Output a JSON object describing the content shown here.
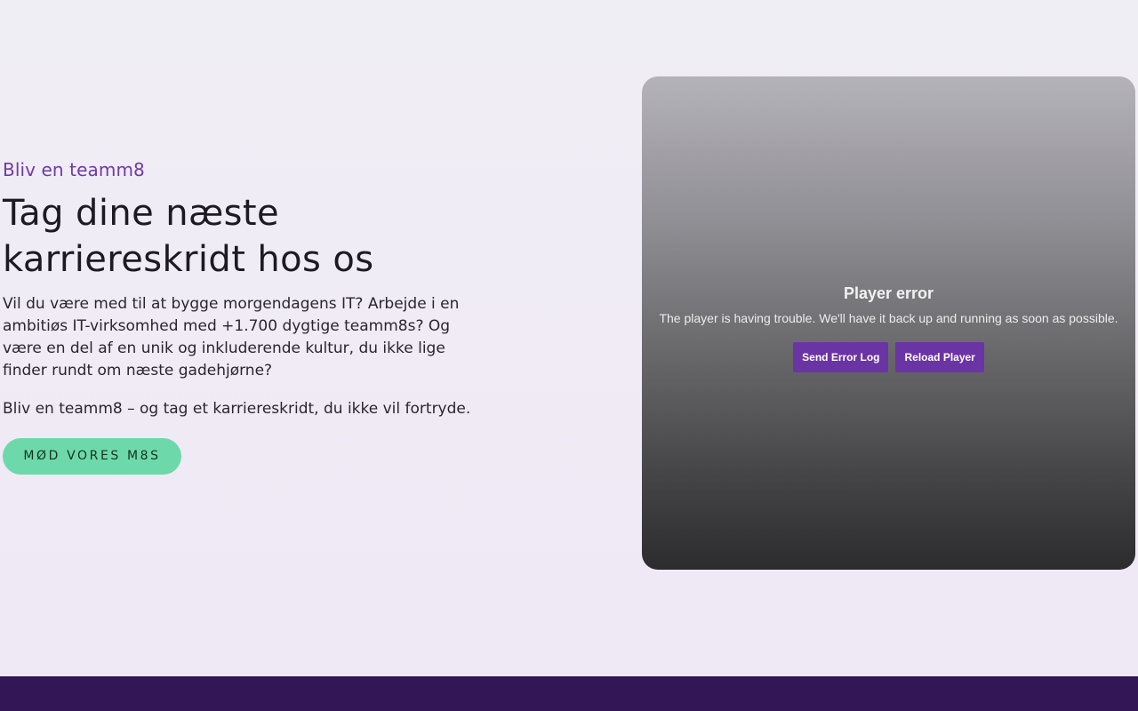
{
  "hero": {
    "eyebrow": "Bliv en teamm8",
    "headline": "Tag dine næste karriereskridt hos os",
    "paragraph1": "Vil du være med til at bygge morgendagens IT? Arbejde i en ambitiøs IT-virksomhed med +1.700 dygtige teamm8s? Og være en del af en unik og inkluderende kultur, du ikke lige finder rundt om næste gadehjørne?",
    "paragraph2": "Bliv en teamm8 – og tag et karriereskridt, du ikke vil fortryde.",
    "cta_label": "MØD VORES M8S"
  },
  "player": {
    "error_title": "Player error",
    "error_message": "The player is having trouble. We'll have it back up and running as soon as possible.",
    "send_log_label": "Send Error Log",
    "reload_label": "Reload Player"
  },
  "colors": {
    "accent": "#6e3aa6",
    "cta_background": "#6dd9ab",
    "player_button": "#6b34a5",
    "footer": "#321656"
  }
}
